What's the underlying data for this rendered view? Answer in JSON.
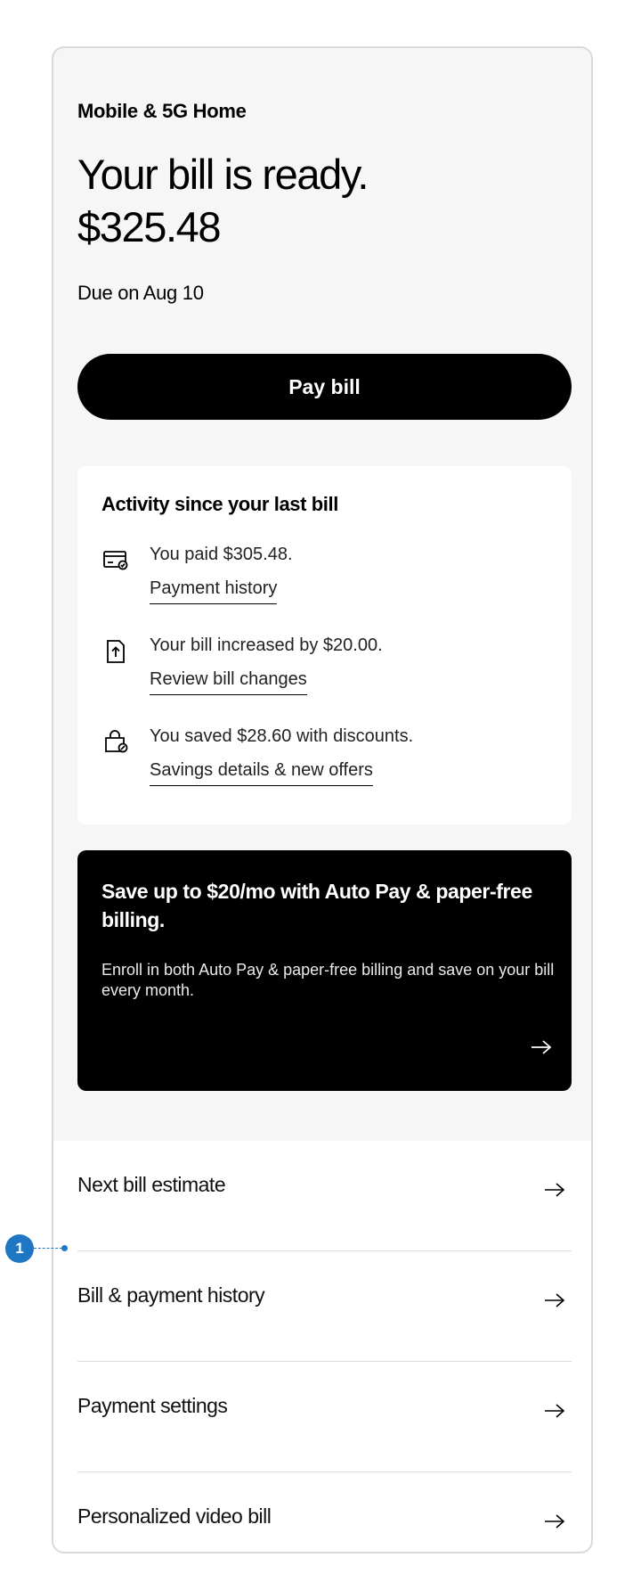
{
  "account_label": "Mobile & 5G Home",
  "headline": "Your bill is ready.",
  "amount": "$325.48",
  "due_text": "Due on Aug 10",
  "pay_button_label": "Pay bill",
  "activity": {
    "title": "Activity since your last bill",
    "items": [
      {
        "icon": "credit-card-icon",
        "text": "You paid $305.48.",
        "link": "Payment history"
      },
      {
        "icon": "bill-increase-icon",
        "text": "Your bill increased by $20.00.",
        "link": "Review bill changes"
      },
      {
        "icon": "shopping-bag-icon",
        "text": "You saved $28.60 with discounts.",
        "link": "Savings details & new offers"
      }
    ]
  },
  "promo": {
    "title": "Save up to $20/mo with Auto Pay & paper-free billing.",
    "text": "Enroll in both Auto Pay & paper-free billing and save on your bill every month."
  },
  "links": [
    {
      "label": "Next bill estimate"
    },
    {
      "label": "Bill & payment history"
    },
    {
      "label": "Payment settings"
    },
    {
      "label": "Personalized video bill"
    }
  ],
  "annotation_number": "1",
  "colors": {
    "annotation": "#1f77c4",
    "panel_background": "#f6f6f6",
    "button": "#000000"
  }
}
